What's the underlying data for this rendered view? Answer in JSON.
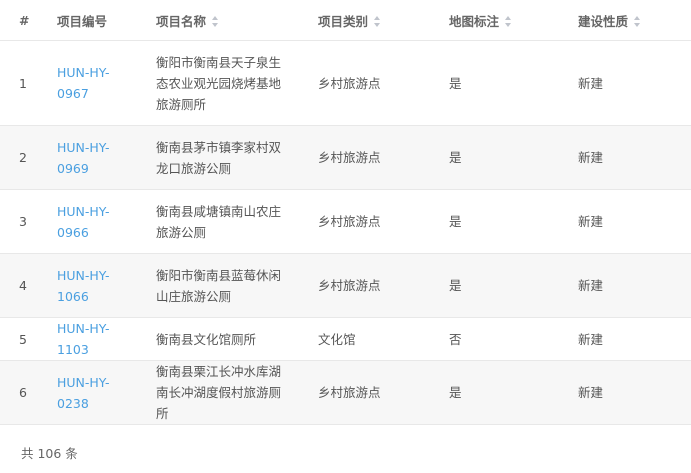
{
  "table": {
    "headers": {
      "index": "#",
      "code": "项目编号",
      "name": "项目名称",
      "type": "项目类别",
      "map": "地图标注",
      "nature": "建设性质"
    },
    "rows": [
      {
        "index": "1",
        "code": "HUN-HY-0967",
        "name": "衡阳市衡南县天子泉生态农业观光园烧烤基地旅游厕所",
        "type": "乡村旅游点",
        "map": "是",
        "nature": "新建"
      },
      {
        "index": "2",
        "code": "HUN-HY-0969",
        "name": "衡南县茅市镇李家村双龙口旅游公厕",
        "type": "乡村旅游点",
        "map": "是",
        "nature": "新建"
      },
      {
        "index": "3",
        "code": "HUN-HY-0966",
        "name": "衡南县咸塘镇南山农庄旅游公厕",
        "type": "乡村旅游点",
        "map": "是",
        "nature": "新建"
      },
      {
        "index": "4",
        "code": "HUN-HY-1066",
        "name": "衡阳市衡南县蓝莓休闲山庄旅游公厕",
        "type": "乡村旅游点",
        "map": "是",
        "nature": "新建"
      },
      {
        "index": "5",
        "code": "HUN-HY-1103",
        "name": "衡南县文化馆厕所",
        "type": "文化馆",
        "map": "否",
        "nature": "新建"
      },
      {
        "index": "6",
        "code": "HUN-HY-0238",
        "name": "衡南县栗江长冲水库湖南长冲湖度假村旅游厕所",
        "type": "乡村旅游点",
        "map": "是",
        "nature": "新建"
      }
    ]
  },
  "footer": {
    "total_text": "共 106 条"
  },
  "colors": {
    "link": "#4a9fe0",
    "row_stripe": "#f7f7f7",
    "border": "#e8e8e8"
  }
}
